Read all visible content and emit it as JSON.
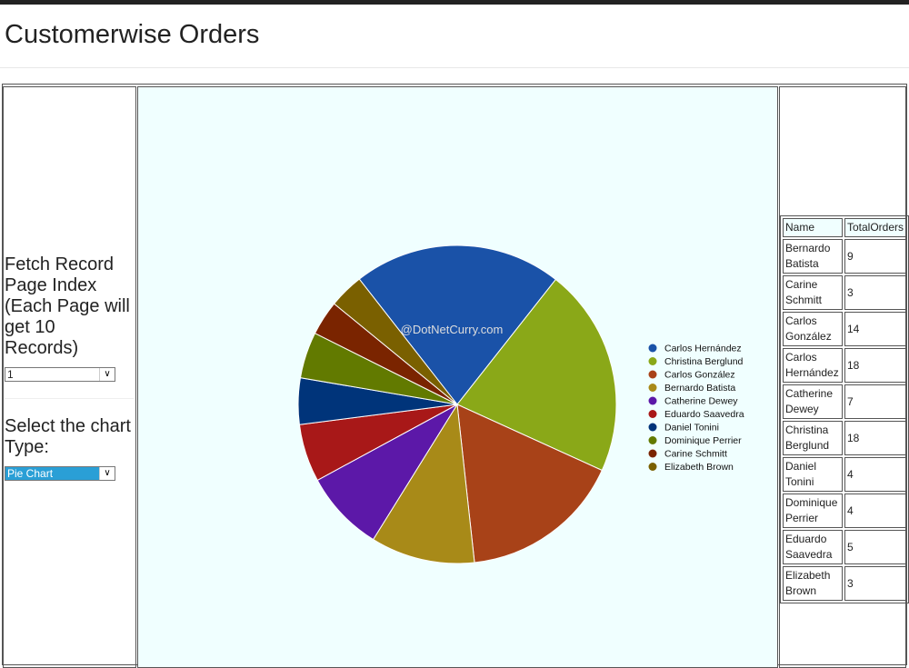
{
  "page": {
    "title": "Customerwise Orders"
  },
  "controls": {
    "page_index_label": "Fetch Record Page Index (Each Page will get 10 Records)",
    "page_index_value": "1",
    "chart_type_label": "Select the chart Type:",
    "chart_type_value": "Pie Chart"
  },
  "table": {
    "headers": [
      "Name",
      "TotalOrders"
    ],
    "rows": [
      [
        "Bernardo Batista",
        "9"
      ],
      [
        "Carine Schmitt",
        "3"
      ],
      [
        "Carlos González",
        "14"
      ],
      [
        "Carlos Hernández",
        "18"
      ],
      [
        "Catherine Dewey",
        "7"
      ],
      [
        "Christina Berglund",
        "18"
      ],
      [
        "Daniel Tonini",
        "4"
      ],
      [
        "Dominique Perrier",
        "4"
      ],
      [
        "Eduardo Saavedra",
        "5"
      ],
      [
        "Elizabeth Brown",
        "3"
      ]
    ]
  },
  "chart_data": {
    "type": "pie",
    "title": "",
    "watermark": "@DotNetCurry.com",
    "legend_position": "right",
    "categories": [
      "Carlos Hernández",
      "Christina Berglund",
      "Carlos González",
      "Bernardo Batista",
      "Catherine Dewey",
      "Eduardo Saavedra",
      "Daniel Tonini",
      "Dominique Perrier",
      "Carine Schmitt",
      "Elizabeth Brown"
    ],
    "values": [
      18,
      18,
      14,
      9,
      7,
      5,
      4,
      4,
      3,
      3
    ],
    "colors": [
      "#1a52a8",
      "#8aa818",
      "#a84218",
      "#a88a18",
      "#5c18a8",
      "#a81818",
      "#00347a",
      "#627a00",
      "#7a2400",
      "#7a6000"
    ]
  }
}
